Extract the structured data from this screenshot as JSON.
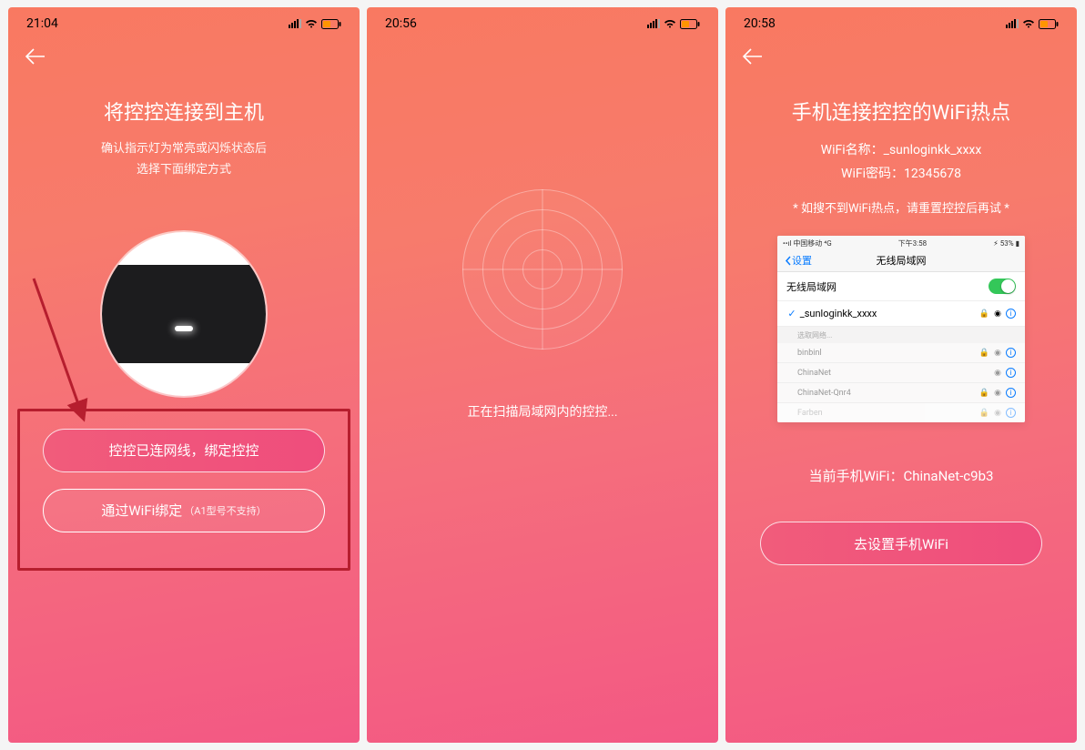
{
  "phone1": {
    "status_time": "21:04",
    "title": "将控控连接到主机",
    "subtitle_l1": "确认指示灯为常亮或闪烁状态后",
    "subtitle_l2": "选择下面绑定方式",
    "btn1": "控控已连网线，绑定控控",
    "btn2_main": "通过WiFi绑定",
    "btn2_sub": "（A1型号不支持）"
  },
  "phone2": {
    "status_time": "20:56",
    "scan_text": "正在扫描局域网内的控控..."
  },
  "phone3": {
    "status_time": "20:58",
    "title": "手机连接控控的WiFi热点",
    "wifi_name_label": "WiFi名称：",
    "wifi_name_value": "_sunloginkk_xxxx",
    "wifi_pw_label": "WiFi密码：",
    "wifi_pw_value": "12345678",
    "hint": "* 如搜不到WiFi热点，请重置控控后再试 *",
    "ios": {
      "carrier": "中国移动",
      "time": "下午3:58",
      "battery": "53%",
      "back": "设置",
      "nav_title": "无线局域网",
      "row_toggle": "无线局域网",
      "selected": "_sunloginkk_xxxx",
      "section": "选取网络...",
      "nets": [
        "binbinl",
        "ChinaNet",
        "ChinaNet-Qnr4",
        "Farben"
      ]
    },
    "current_label": "当前手机WiFi：",
    "current_value": "ChinaNet-c9b3",
    "action": "去设置手机WiFi"
  }
}
